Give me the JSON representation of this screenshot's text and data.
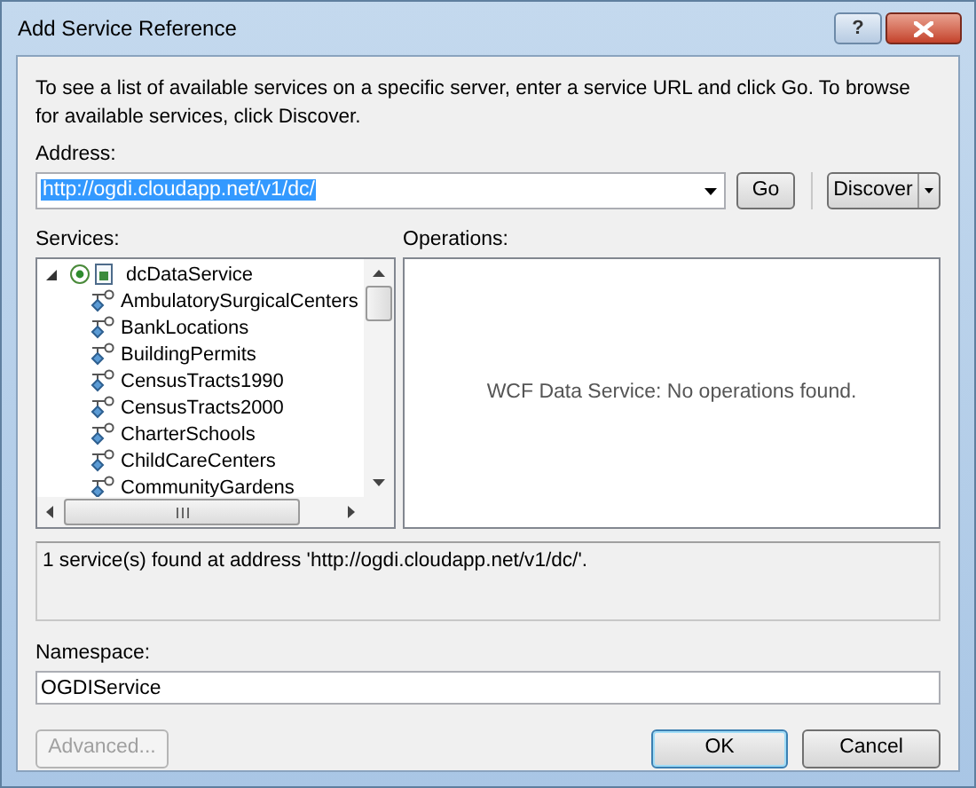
{
  "window": {
    "title": "Add Service Reference",
    "help_glyph": "?"
  },
  "description": "To see a list of available services on a specific server, enter a service URL and click Go. To browse for available services, click Discover.",
  "address": {
    "label": "Address:",
    "value": "http://ogdi.cloudapp.net/v1/dc/",
    "text_selected": true
  },
  "go_button": {
    "label": "Go"
  },
  "discover_button": {
    "label": "Discover"
  },
  "services": {
    "label": "Services:",
    "tree": [
      {
        "label": "dcDataService",
        "expanded": true,
        "children": [
          {
            "label": "AmbulatorySurgicalCenters"
          },
          {
            "label": "BankLocations"
          },
          {
            "label": "BuildingPermits"
          },
          {
            "label": "CensusTracts1990"
          },
          {
            "label": "CensusTracts2000"
          },
          {
            "label": "CharterSchools"
          },
          {
            "label": "ChildCareCenters"
          },
          {
            "label": "CommunityGardens"
          }
        ]
      }
    ]
  },
  "operations": {
    "label": "Operations:",
    "message": "WCF Data Service: No operations found."
  },
  "status": "1 service(s) found at address 'http://ogdi.cloudapp.net/v1/dc/'.",
  "namespace": {
    "label": "Namespace:",
    "value": "OGDIService"
  },
  "buttons": [
    {
      "label": "Advanced...",
      "disabled": true,
      "default": false
    },
    {
      "label": "OK",
      "disabled": false,
      "default": true
    },
    {
      "label": "Cancel",
      "disabled": false,
      "default": false
    }
  ]
}
